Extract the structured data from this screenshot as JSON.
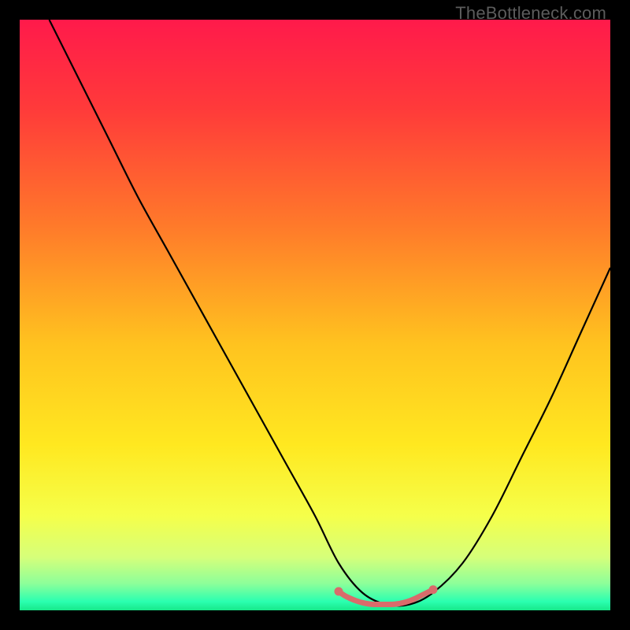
{
  "watermark": "TheBottleneck.com",
  "chart_data": {
    "type": "line",
    "title": "",
    "xlabel": "",
    "ylabel": "",
    "xlim": [
      0,
      100
    ],
    "ylim": [
      0,
      100
    ],
    "grid": false,
    "series": [
      {
        "name": "bottleneck-curve",
        "x": [
          5,
          10,
          15,
          20,
          25,
          30,
          35,
          40,
          45,
          50,
          54,
          58,
          62,
          66,
          70,
          75,
          80,
          85,
          90,
          95,
          100
        ],
        "y": [
          100,
          90,
          80,
          70,
          61,
          52,
          43,
          34,
          25,
          16,
          8,
          3,
          1,
          1,
          3,
          8,
          16,
          26,
          36,
          47,
          58
        ]
      },
      {
        "name": "optimal-range-marker",
        "x": [
          54,
          55,
          56,
          57,
          58,
          59,
          60,
          61,
          62,
          63,
          64,
          65,
          66,
          67,
          68,
          69,
          70
        ],
        "y": [
          3.2,
          2.5,
          2.0,
          1.6,
          1.3,
          1.1,
          1.0,
          1.0,
          1.0,
          1.0,
          1.1,
          1.3,
          1.6,
          2.0,
          2.5,
          3.0,
          3.5
        ]
      }
    ],
    "gradient_stops": [
      {
        "offset": 0.0,
        "color": "#ff1a4b"
      },
      {
        "offset": 0.15,
        "color": "#ff3a3a"
      },
      {
        "offset": 0.35,
        "color": "#ff7a2a"
      },
      {
        "offset": 0.55,
        "color": "#ffc31f"
      },
      {
        "offset": 0.72,
        "color": "#ffe820"
      },
      {
        "offset": 0.84,
        "color": "#f5ff4a"
      },
      {
        "offset": 0.91,
        "color": "#d6ff7a"
      },
      {
        "offset": 0.955,
        "color": "#8cff9a"
      },
      {
        "offset": 0.985,
        "color": "#2bffb0"
      },
      {
        "offset": 1.0,
        "color": "#17e88a"
      }
    ],
    "marker_color": "#d96b6b"
  }
}
